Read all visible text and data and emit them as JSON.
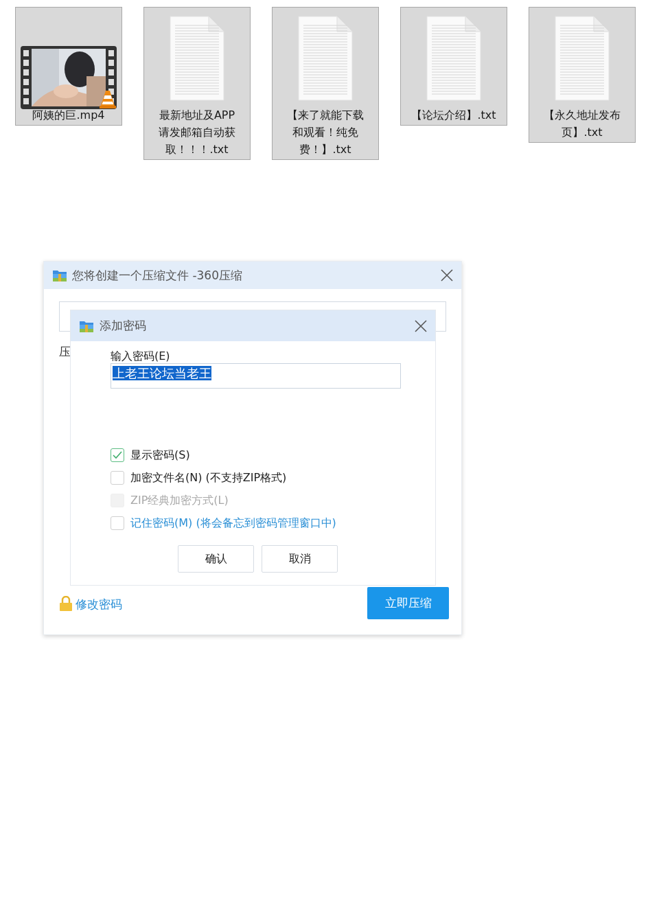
{
  "files": [
    {
      "kind": "video",
      "name": "阿姨的巨.mp4"
    },
    {
      "kind": "text",
      "name": "最新地址及APP请发邮箱自动获取！！！.txt"
    },
    {
      "kind": "text",
      "name": "【来了就能下载和观看！纯免费！】.txt"
    },
    {
      "kind": "text",
      "name": "【论坛介绍】.txt"
    },
    {
      "kind": "text",
      "name": "【永久地址发布页】.txt"
    }
  ],
  "dialog": {
    "title": "您将创建一个压缩文件 -360压缩",
    "partial_label": "压",
    "change_password_link": "修改密码",
    "compress_button": "立即压缩"
  },
  "password_dialog": {
    "title": "添加密码",
    "field_label": "输入密码(E)",
    "value": "上老王论坛当老王",
    "value_selected": true,
    "options": [
      {
        "kind": "plain",
        "label": "显示密码(S)",
        "checked": true,
        "disabled": false
      },
      {
        "kind": "plain",
        "label": "加密文件名(N) (不支持ZIP格式)",
        "checked": false,
        "disabled": false
      },
      {
        "kind": "plain",
        "label": "ZIP经典加密方式(L)",
        "checked": false,
        "disabled": true
      },
      {
        "kind": "link",
        "label": "记住密码(M) (将会备忘到密码管理窗口中)",
        "checked": false,
        "disabled": false
      }
    ],
    "buttons": [
      "确认",
      "取消"
    ]
  }
}
